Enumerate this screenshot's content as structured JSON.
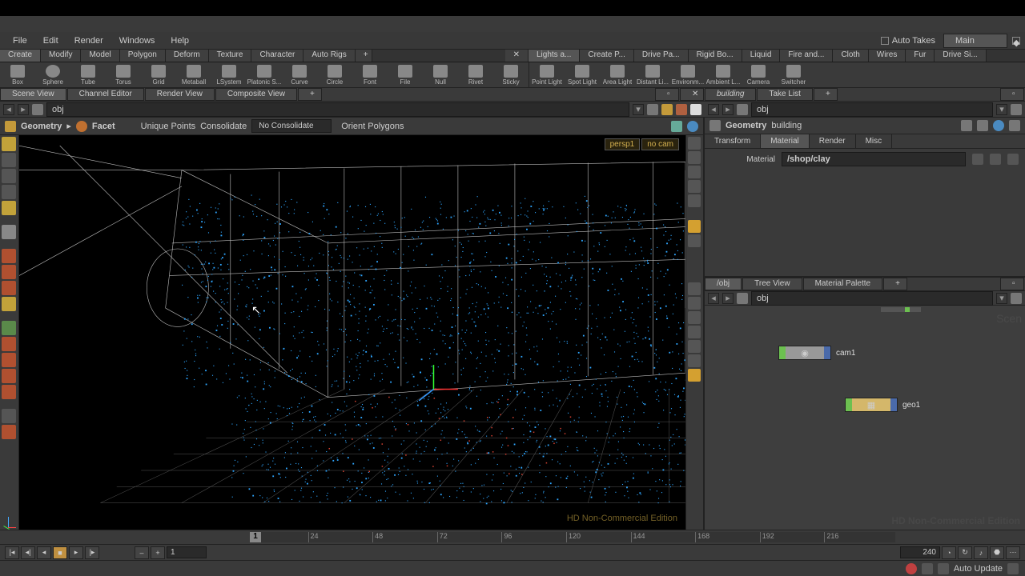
{
  "menubar": {
    "items": [
      "File",
      "Edit",
      "Render",
      "Windows",
      "Help"
    ],
    "auto_takes": "Auto Takes",
    "take": "Main"
  },
  "shelf_tabs_left": [
    "Create",
    "Modify",
    "Model",
    "Polygon",
    "Deform",
    "Texture",
    "Character",
    "Auto Rigs"
  ],
  "shelf_tabs_right": [
    "Lights a...",
    "Create P...",
    "Drive Pa...",
    "Rigid Bo...",
    "Liquid",
    "Fire and...",
    "Cloth",
    "Wires",
    "Fur",
    "Drive Si..."
  ],
  "shelf_tools_left": [
    "Box",
    "Sphere",
    "Tube",
    "Torus",
    "Grid",
    "Metaball",
    "LSystem",
    "Platonic S...",
    "Curve",
    "Circle",
    "Font",
    "File",
    "Null",
    "Rivet",
    "Sticky"
  ],
  "shelf_tools_right": [
    "Point Light",
    "Spot Light",
    "Area Light",
    "Distant Li...",
    "Environm...",
    "Ambient L...",
    "Camera",
    "Switcher"
  ],
  "pane_tabs_left": [
    "Scene View",
    "Channel Editor",
    "Render View",
    "Composite View"
  ],
  "pane_tabs_right": [
    "building",
    "Take List"
  ],
  "path_left": "obj",
  "path_right": "obj",
  "opbar": {
    "geom": "Geometry",
    "facet": "Facet",
    "uniq": "Unique Points",
    "cons": "Consolidate",
    "noc": "No Consolidate",
    "orient": "Orient Polygons"
  },
  "viewport": {
    "cam": "persp1",
    "nocam": "no cam",
    "watermark": "HD Non-Commercial Edition"
  },
  "params": {
    "type": "Geometry",
    "name": "building",
    "tabs": [
      "Transform",
      "Material",
      "Render",
      "Misc"
    ],
    "active_tab": "Material",
    "material_label": "Material",
    "material_value": "/shop/clay"
  },
  "net_tabs": [
    "/obj",
    "Tree View",
    "Material Palette"
  ],
  "net_path": "obj",
  "nodes": [
    {
      "name": "cam1"
    },
    {
      "name": "geo1"
    }
  ],
  "watermark2": "HD Non-Commercial Edition",
  "timeline": {
    "cursor": "1",
    "ticks": [
      "24",
      "48",
      "72",
      "96",
      "120",
      "144",
      "168",
      "192",
      "216"
    ],
    "end": "240"
  },
  "playbar": {
    "start": "1",
    "end": "240",
    "auto_update": "Auto Update"
  }
}
